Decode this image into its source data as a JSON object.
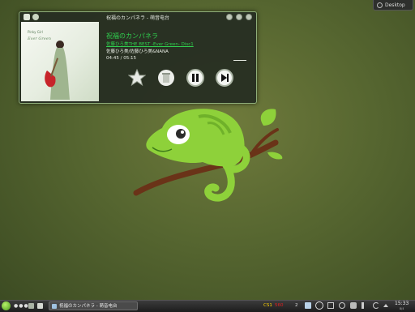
{
  "desktop_button": {
    "label": "Desktop"
  },
  "player": {
    "window_title": "祝福のカンパネラ - 萌音电台",
    "album_art_caption": "Pinky Girl",
    "album_art_caption2": "Ever Green",
    "track_title": "祝福のカンパネラ",
    "album": "佐藤ひろ美THE BEST -Ever Green- Disc1",
    "artist": "佐藤ひろ美/佐藤ひろ美&NANA",
    "time": "04:45 / 05:15",
    "progress_fraction": 0.9,
    "controls": [
      "favorite-icon",
      "trash-icon",
      "pause-icon",
      "next-icon"
    ]
  },
  "taskbar": {
    "launcher_dots": "●●●",
    "task_label": "祝福のカンパネラ - 萌音电台",
    "cpu_label": "CS1",
    "cpu_value": "560",
    "workspace": "2",
    "clock_time": "15:33",
    "clock_date": "8/4"
  },
  "colors": {
    "accent_green": "#2fcf4e",
    "window_bg": "#262e22",
    "window_border": "#8fae7a",
    "desktop_bg": "#566630"
  }
}
